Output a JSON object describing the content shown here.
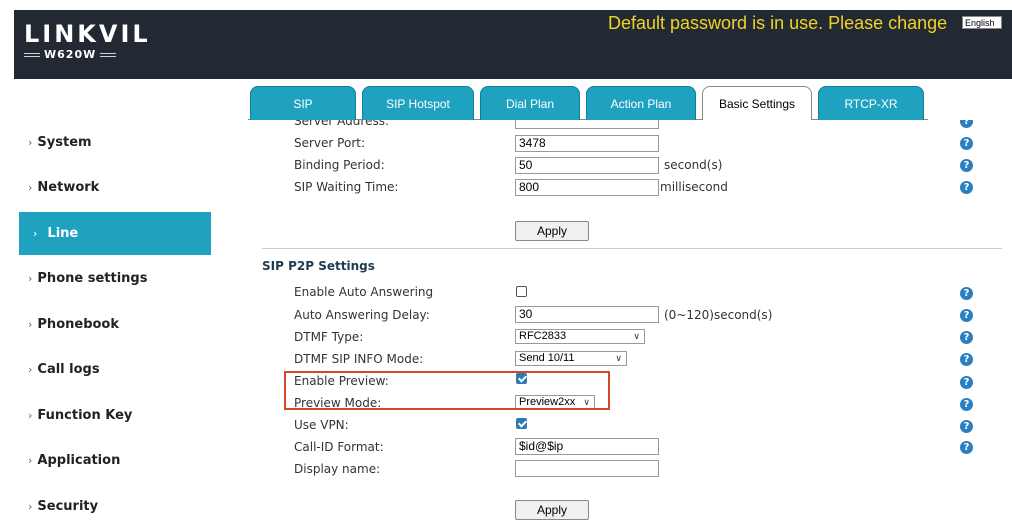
{
  "header": {
    "logo_main": "LINKVIL",
    "logo_sub": "W620W",
    "warning": "Default password is in use. Please change",
    "language": "English"
  },
  "sidebar": {
    "items": [
      {
        "label": "System",
        "active": false
      },
      {
        "label": "Network",
        "active": false
      },
      {
        "label": "Line",
        "active": true
      },
      {
        "label": "Phone settings",
        "active": false
      },
      {
        "label": "Phonebook",
        "active": false
      },
      {
        "label": "Call logs",
        "active": false
      },
      {
        "label": "Function Key",
        "active": false
      },
      {
        "label": "Application",
        "active": false
      },
      {
        "label": "Security",
        "active": false
      }
    ]
  },
  "tabs": [
    "SIP",
    "SIP Hotspot",
    "Dial Plan",
    "Action Plan",
    "Basic Settings",
    "RTCP-XR"
  ],
  "active_tab": "Basic Settings",
  "stun": {
    "server_address_label": "Server Address:",
    "server_address_value": "",
    "server_port_label": "Server Port:",
    "server_port_value": "3478",
    "binding_period_label": "Binding Period:",
    "binding_period_value": "50",
    "binding_period_unit": "second(s)",
    "sip_waiting_label": "SIP Waiting Time:",
    "sip_waiting_value": "800",
    "sip_waiting_unit": "millisecond",
    "apply": "Apply"
  },
  "p2p": {
    "title": "SIP P2P Settings",
    "auto_answer_label": "Enable Auto Answering",
    "auto_answer_checked": false,
    "auto_delay_label": "Auto Answering Delay:",
    "auto_delay_value": "30",
    "auto_delay_unit": "(0~120)second(s)",
    "dtmf_type_label": "DTMF Type:",
    "dtmf_type_value": "RFC2833",
    "dtmf_info_label": "DTMF SIP INFO Mode:",
    "dtmf_info_value": "Send 10/11",
    "preview_label": "Enable Preview:",
    "preview_checked": true,
    "preview_mode_label": "Preview Mode:",
    "preview_mode_value": "Preview2xx",
    "vpn_label": "Use VPN:",
    "vpn_checked": true,
    "callid_label": "Call-ID Format:",
    "callid_value": "$id@$ip",
    "display_name_label": "Display name:",
    "display_name_value": "",
    "apply": "Apply"
  },
  "help_glyph": "?",
  "colors": {
    "accent": "#1fa2c0",
    "header_bg": "#222933",
    "warning": "#f1d226",
    "highlight": "#d9472b"
  }
}
